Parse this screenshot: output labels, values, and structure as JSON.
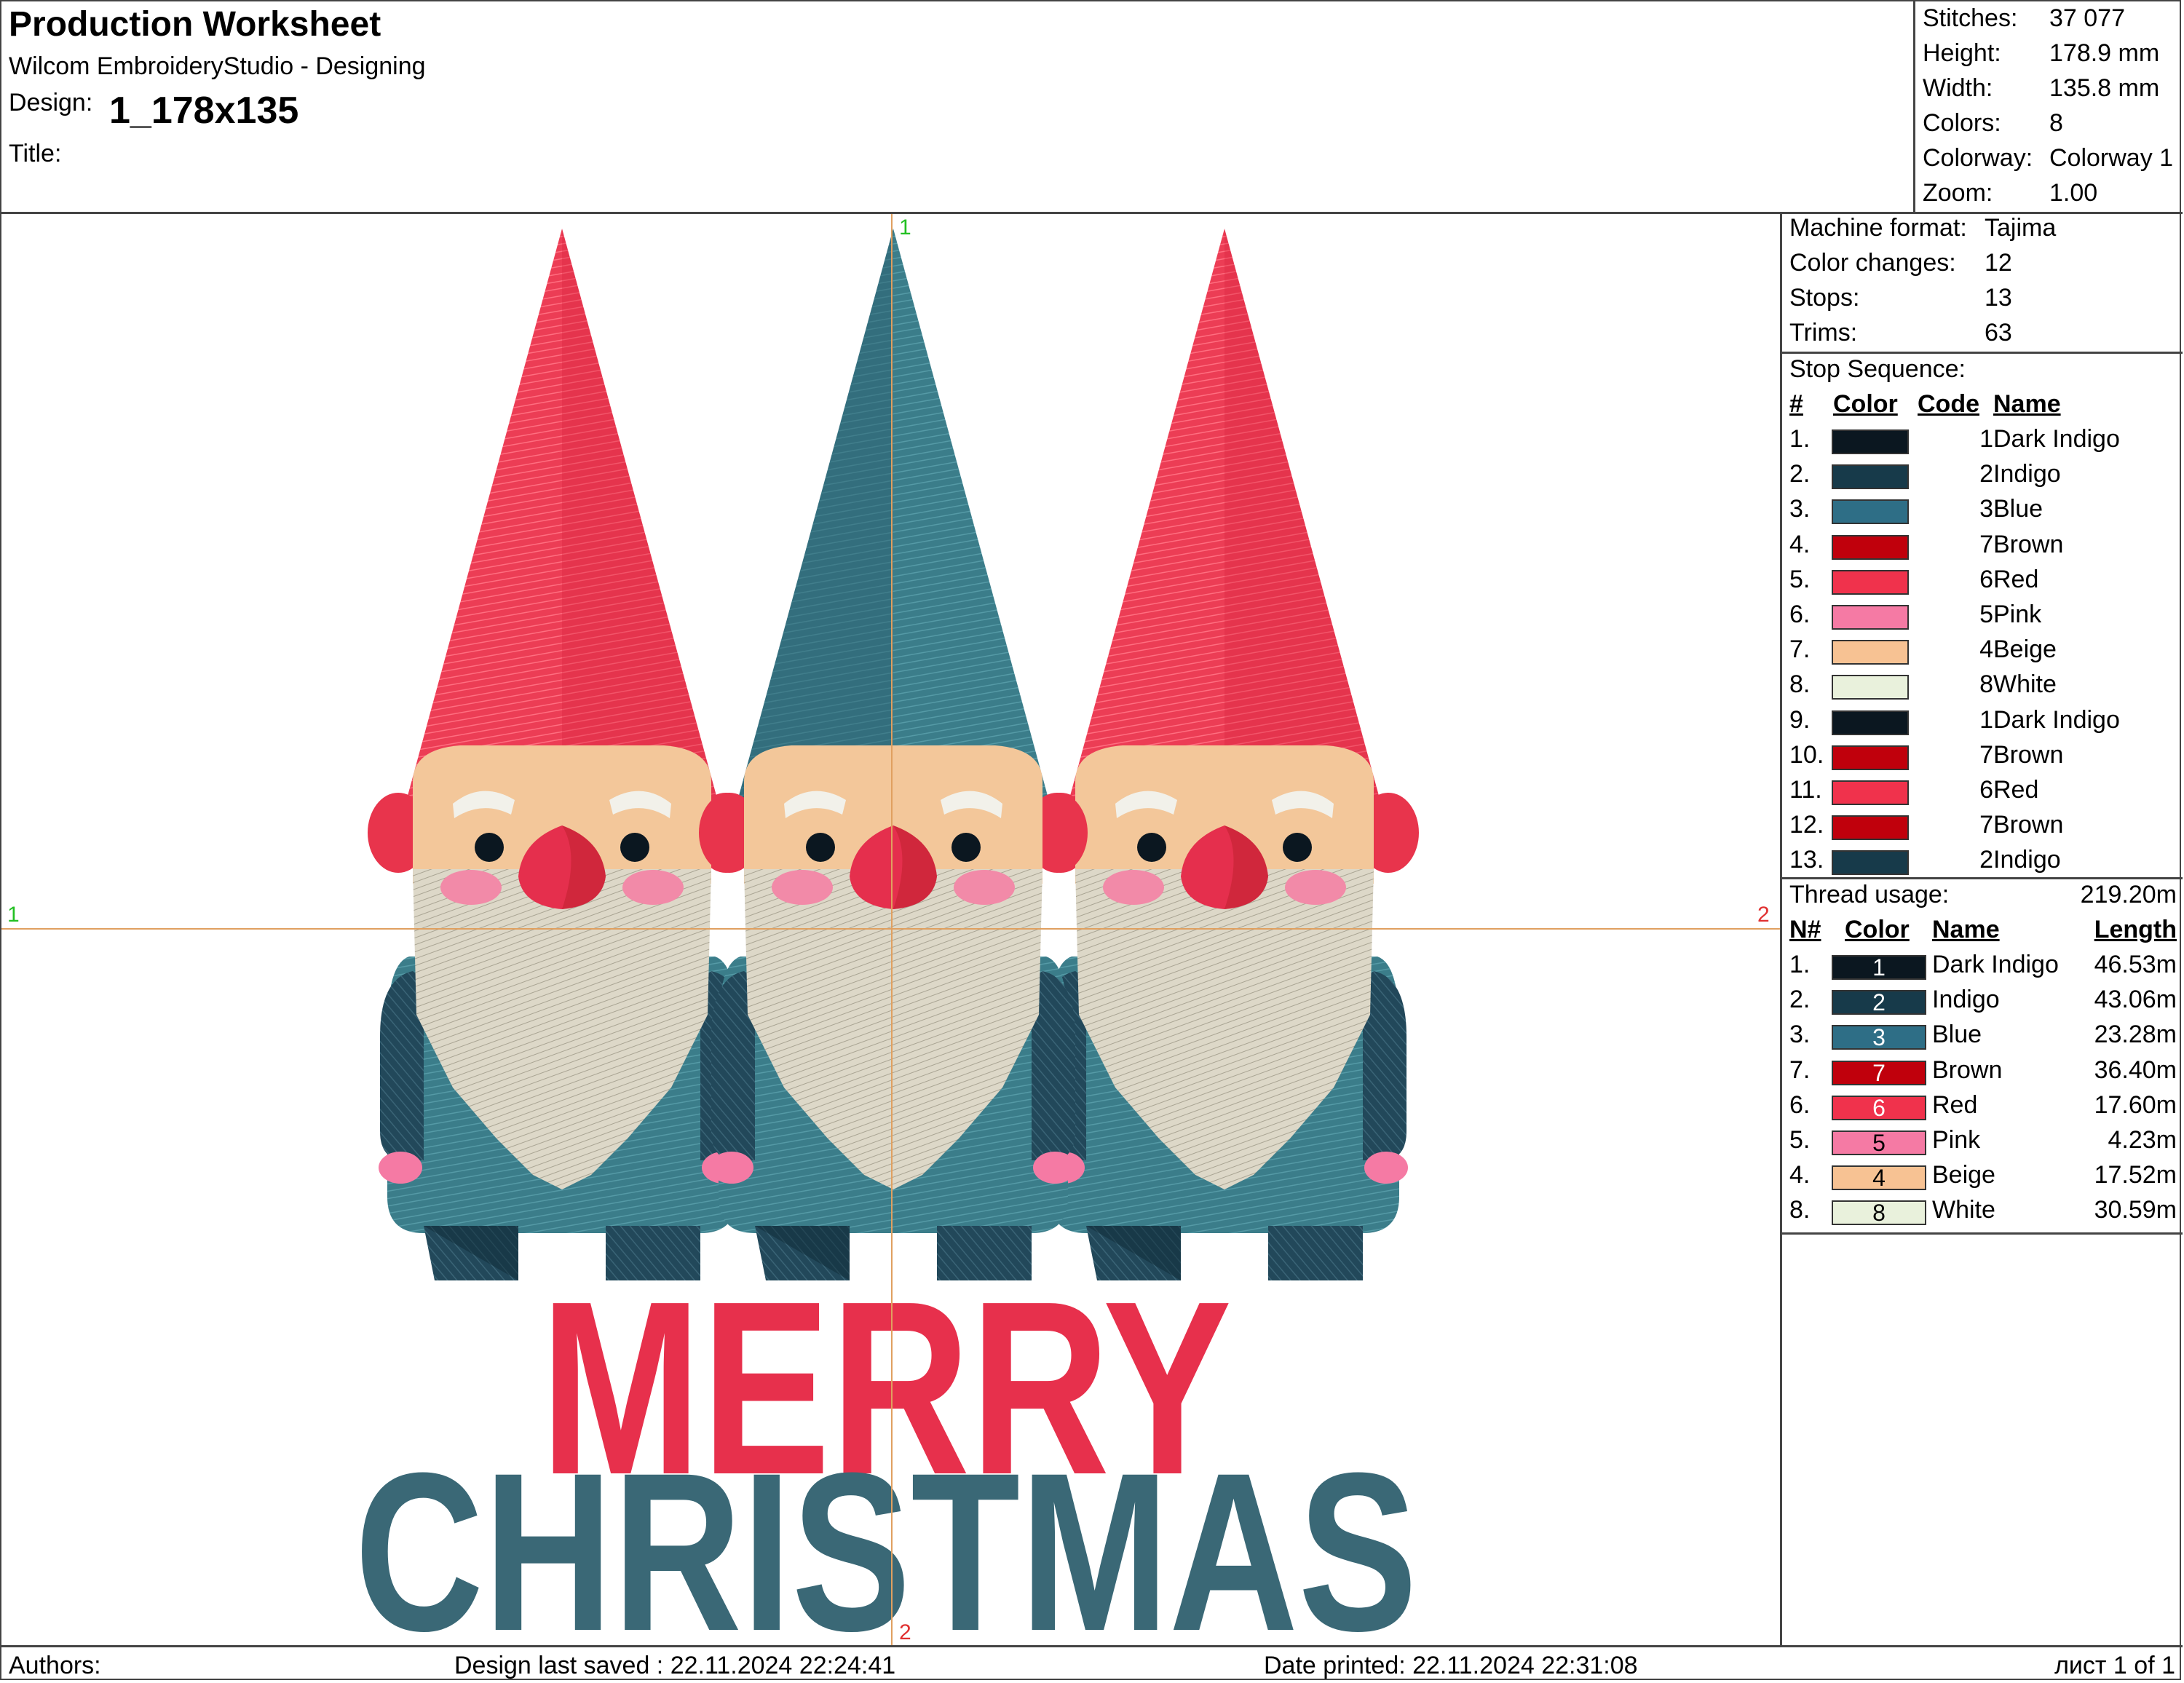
{
  "header": {
    "title": "Production Worksheet",
    "app": "Wilcom EmbroideryStudio - Designing",
    "design_label": "Design:",
    "design_value": "1_178x135",
    "title_label": "Title:"
  },
  "stats": [
    {
      "label": "Stitches:",
      "value": "37 077"
    },
    {
      "label": "Height:",
      "value": "178.9 mm"
    },
    {
      "label": "Width:",
      "value": "135.8 mm"
    },
    {
      "label": "Colors:",
      "value": "8"
    },
    {
      "label": "Colorway:",
      "value": "Colorway 1"
    },
    {
      "label": "Zoom:",
      "value": "1.00"
    }
  ],
  "machine": [
    {
      "label": "Machine format:",
      "value": "Tajima"
    },
    {
      "label": "Color changes:",
      "value": "12"
    },
    {
      "label": "Stops:",
      "value": "13"
    },
    {
      "label": "Trims:",
      "value": "63"
    }
  ],
  "stop_sequence": {
    "title": "Stop Sequence:",
    "headers": {
      "num": "#",
      "color": "Color",
      "code": "Code",
      "name": "Name"
    },
    "rows": [
      {
        "num": "1.",
        "hex": "#0b1720",
        "code": "1",
        "name": "Dark Indigo"
      },
      {
        "num": "2.",
        "hex": "#173a4a",
        "code": "2",
        "name": "Indigo"
      },
      {
        "num": "3.",
        "hex": "#2e6e86",
        "code": "3",
        "name": "Blue"
      },
      {
        "num": "4.",
        "hex": "#c0000c",
        "code": "7",
        "name": "Brown"
      },
      {
        "num": "5.",
        "hex": "#f0324c",
        "code": "6",
        "name": "Red"
      },
      {
        "num": "6.",
        "hex": "#f57aa4",
        "code": "5",
        "name": "Pink"
      },
      {
        "num": "7.",
        "hex": "#f7c293",
        "code": "4",
        "name": "Beige"
      },
      {
        "num": "8.",
        "hex": "#e9f1dc",
        "code": "8",
        "name": "White"
      },
      {
        "num": "9.",
        "hex": "#0b1720",
        "code": "1",
        "name": "Dark Indigo"
      },
      {
        "num": "10.",
        "hex": "#c0000c",
        "code": "7",
        "name": "Brown"
      },
      {
        "num": "11.",
        "hex": "#f0324c",
        "code": "6",
        "name": "Red"
      },
      {
        "num": "12.",
        "hex": "#c0000c",
        "code": "7",
        "name": "Brown"
      },
      {
        "num": "13.",
        "hex": "#173a4a",
        "code": "2",
        "name": "Indigo"
      }
    ]
  },
  "thread_usage": {
    "title": "Thread usage:",
    "total": "219.20m",
    "headers": {
      "num": "N#",
      "color": "Color",
      "name": "Name",
      "length": "Length"
    },
    "rows": [
      {
        "num": "1.",
        "hex": "#0b1720",
        "code": "1",
        "name": "Dark Indigo",
        "length": "46.53m",
        "light": false
      },
      {
        "num": "2.",
        "hex": "#173a4a",
        "code": "2",
        "name": "Indigo",
        "length": "43.06m",
        "light": false
      },
      {
        "num": "3.",
        "hex": "#2e6e86",
        "code": "3",
        "name": "Blue",
        "length": "23.28m",
        "light": false
      },
      {
        "num": "7.",
        "hex": "#c0000c",
        "code": "7",
        "name": "Brown",
        "length": "36.40m",
        "light": false
      },
      {
        "num": "6.",
        "hex": "#f0324c",
        "code": "6",
        "name": "Red",
        "length": "17.60m",
        "light": false
      },
      {
        "num": "5.",
        "hex": "#f57aa4",
        "code": "5",
        "name": "Pink",
        "length": "4.23m",
        "light": true
      },
      {
        "num": "4.",
        "hex": "#f7c293",
        "code": "4",
        "name": "Beige",
        "length": "17.52m",
        "light": true
      },
      {
        "num": "8.",
        "hex": "#e9f1dc",
        "code": "8",
        "name": "White",
        "length": "30.59m",
        "light": true
      }
    ]
  },
  "design_text": {
    "line1": "MERRY",
    "line2": "CHRISTMAS"
  },
  "axes": {
    "v_top": "1",
    "v_bottom": "2",
    "h_left": "1",
    "h_right": "2"
  },
  "footer": {
    "authors": "Authors:",
    "saved": "Design last saved : 22.11.2024 22:24:41",
    "printed": "Date printed: 22.11.2024 22:31:08",
    "page": "лист 1 of 1"
  }
}
